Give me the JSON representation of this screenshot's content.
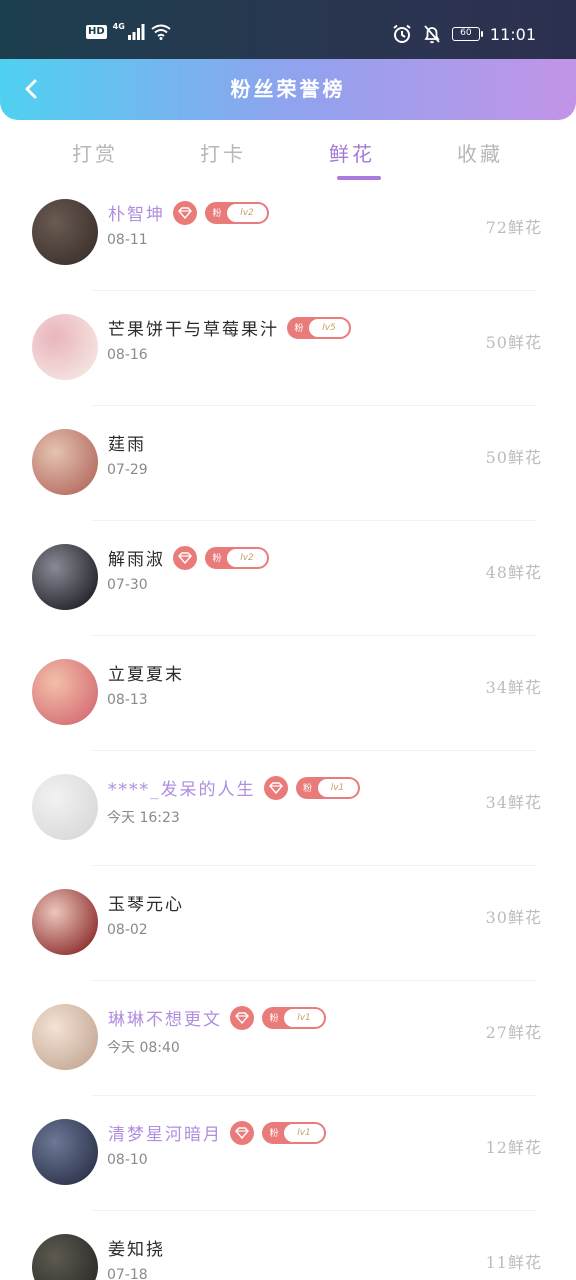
{
  "status_bar": {
    "hd": "HD",
    "network": "4G",
    "battery": "60",
    "time": "11:01"
  },
  "header": {
    "title": "粉丝荣誉榜",
    "back_icon": "chevron-left-icon"
  },
  "tabs": [
    {
      "label": "打赏",
      "active": false
    },
    {
      "label": "打卡",
      "active": false
    },
    {
      "label": "鲜花",
      "active": true
    },
    {
      "label": "收藏",
      "active": false
    }
  ],
  "fan_badge_label": "粉",
  "colors": {
    "header_gradient": [
      "#4fd1f1",
      "#8fa3ee",
      "#c294e8"
    ],
    "active_tab": "#a57ad6",
    "vip_name": "#b08ee0",
    "badge": "#ea7b7b"
  },
  "ranking": [
    {
      "name": "朴智坤",
      "vip": true,
      "gem": true,
      "level": "lv2",
      "date": "08-11",
      "count": "72鲜花",
      "avatar": [
        "#3b302c",
        "#6a5a52"
      ]
    },
    {
      "name": "芒果饼干与草莓果汁",
      "vip": false,
      "gem": false,
      "level": "lv5",
      "date": "08-16",
      "count": "50鲜花",
      "avatar": [
        "#f6e6e2",
        "#e9b5bd"
      ]
    },
    {
      "name": "莛雨",
      "vip": false,
      "gem": false,
      "level": "",
      "date": "07-29",
      "count": "50鲜花",
      "avatar": [
        "#b46a5e",
        "#e4c3b2"
      ]
    },
    {
      "name": "解雨淑",
      "vip": false,
      "gem": true,
      "level": "lv2",
      "date": "07-30",
      "count": "48鲜花",
      "avatar": [
        "#1e1e24",
        "#8a8a96"
      ]
    },
    {
      "name": "立夏夏末",
      "vip": false,
      "gem": false,
      "level": "",
      "date": "08-13",
      "count": "34鲜花",
      "avatar": [
        "#d46b74",
        "#f3c0a8"
      ]
    },
    {
      "name": "****_发呆的人生",
      "vip": true,
      "gem": true,
      "level": "lv1",
      "date": "今天 16:23",
      "count": "34鲜花",
      "avatar": [
        "#d8d8d8",
        "#f2f2f2"
      ]
    },
    {
      "name": "玉琴元心",
      "vip": false,
      "gem": false,
      "level": "",
      "date": "08-02",
      "count": "30鲜花",
      "avatar": [
        "#8a2a2a",
        "#ecc6bb"
      ]
    },
    {
      "name": "琳琳不想更文",
      "vip": true,
      "gem": true,
      "level": "lv1",
      "date": "今天 08:40",
      "count": "27鲜花",
      "avatar": [
        "#c4a893",
        "#f3e2d6"
      ]
    },
    {
      "name": "清梦星河暗月",
      "vip": true,
      "gem": true,
      "level": "lv1",
      "date": "08-10",
      "count": "12鲜花",
      "avatar": [
        "#2a3148",
        "#6d7896"
      ]
    },
    {
      "name": "姜知挠",
      "vip": false,
      "gem": false,
      "level": "",
      "date": "07-18",
      "count": "11鲜花",
      "avatar": [
        "#2a2a28",
        "#5e5a50"
      ]
    }
  ]
}
